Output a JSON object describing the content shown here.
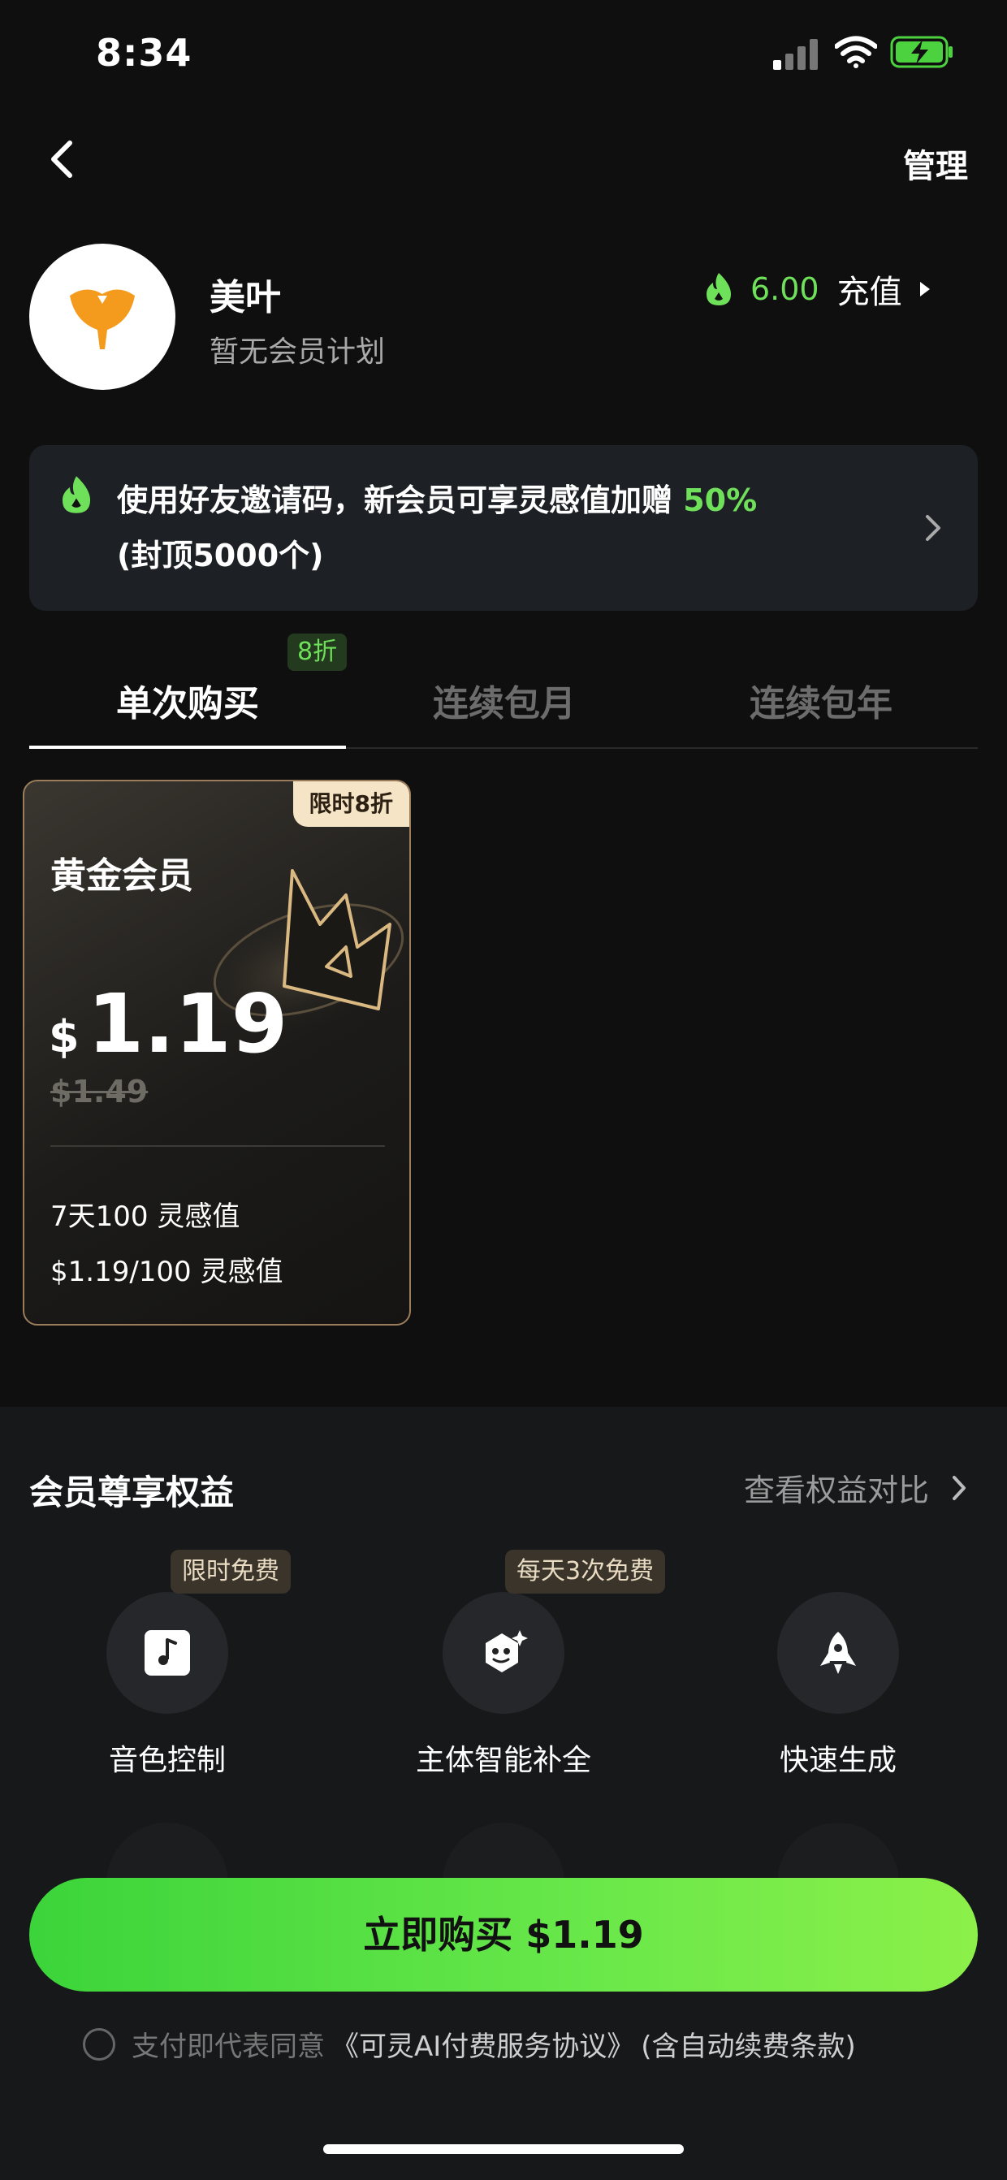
{
  "status_bar": {
    "time": "8:34"
  },
  "header": {
    "manage_label": "管理"
  },
  "profile": {
    "name": "美叶",
    "plan": "暂无会员计划",
    "balance": "6.00",
    "recharge_label": "充值"
  },
  "invite_banner": {
    "text_main": "使用好友邀请码，新会员可享灵感值加赠 ",
    "text_highlight": "50%",
    "text_sub": "(封顶5000个)"
  },
  "tabs": [
    {
      "label": "单次购买",
      "badge": "8折",
      "active": true
    },
    {
      "label": "连续包月",
      "active": false
    },
    {
      "label": "连续包年",
      "active": false
    }
  ],
  "plan_card": {
    "tag": "限时8折",
    "title": "黄金会员",
    "currency": "$",
    "price": "1.19",
    "original_price": "$1.49",
    "line1": "7天100 灵感值",
    "line2": "$1.19/100 灵感值"
  },
  "benefits": {
    "title": "会员尊享权益",
    "compare_label": "查看权益对比",
    "items": [
      {
        "label": "音色控制",
        "badge": "限时免费",
        "icon": "music-note-icon"
      },
      {
        "label": "主体智能补全",
        "badge": "每天3次免费",
        "icon": "face-sparkle-icon"
      },
      {
        "label": "快速生成",
        "badge": "",
        "icon": "rocket-icon"
      }
    ]
  },
  "buy_button": {
    "label": "立即购买 $1.19"
  },
  "agreement": {
    "pre": "支付即代表同意",
    "link": "《可灵AI付费服务协议》",
    "post": "(含自动续费条款)"
  },
  "colors": {
    "accent_green": "#6fe05a",
    "gold_border": "#9b7d5b",
    "tag_bg": "#f6e4c7"
  }
}
